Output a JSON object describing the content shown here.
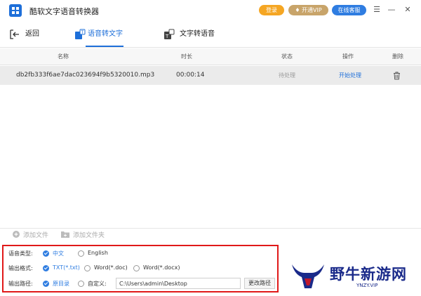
{
  "titlebar": {
    "app_title": "酷软文字语音转换器",
    "login_label": "登录",
    "vip_label": "开通VIP",
    "service_label": "在线客服",
    "menu_icon": "menu-icon",
    "minimize_icon": "minimize-icon",
    "close_icon": "close-icon"
  },
  "nav": {
    "back_label": "返回",
    "tabs": [
      {
        "label": "语音转文字",
        "active": true
      },
      {
        "label": "文字转语音",
        "active": false
      }
    ]
  },
  "table": {
    "headers": {
      "name": "名称",
      "duration": "时长",
      "status": "状态",
      "action": "操作",
      "delete": "删除"
    },
    "rows": [
      {
        "name": "db2fb333f6ae7dac023694f9b5320010.mp3",
        "duration": "00:00:14",
        "status": "待处理",
        "action": "开始处理"
      }
    ]
  },
  "toolbar": {
    "add_file_label": "添加文件",
    "add_folder_label": "添加文件夹"
  },
  "options": {
    "voice_type": {
      "label": "语音类型:",
      "choices": [
        "中文",
        "English"
      ],
      "selected": "中文"
    },
    "output_format": {
      "label": "输出格式:",
      "choices": [
        "TXT(*.txt)",
        "Word(*.doc)",
        "Word(*.docx)"
      ],
      "selected": "TXT(*.txt)"
    },
    "output_path": {
      "label": "输出路径:",
      "choices": [
        "原目录",
        "自定义:"
      ],
      "selected": "原目录",
      "path_value": "C:\\Users\\admin\\Desktop",
      "change_label": "更改路径"
    }
  },
  "watermark": {
    "text": "野牛新游网",
    "url": "YNZY.VIP"
  },
  "colors": {
    "accent": "#1e6fd9",
    "login": "#f5a623",
    "vip": "#c8a46a",
    "highlight_border": "#e01919"
  }
}
